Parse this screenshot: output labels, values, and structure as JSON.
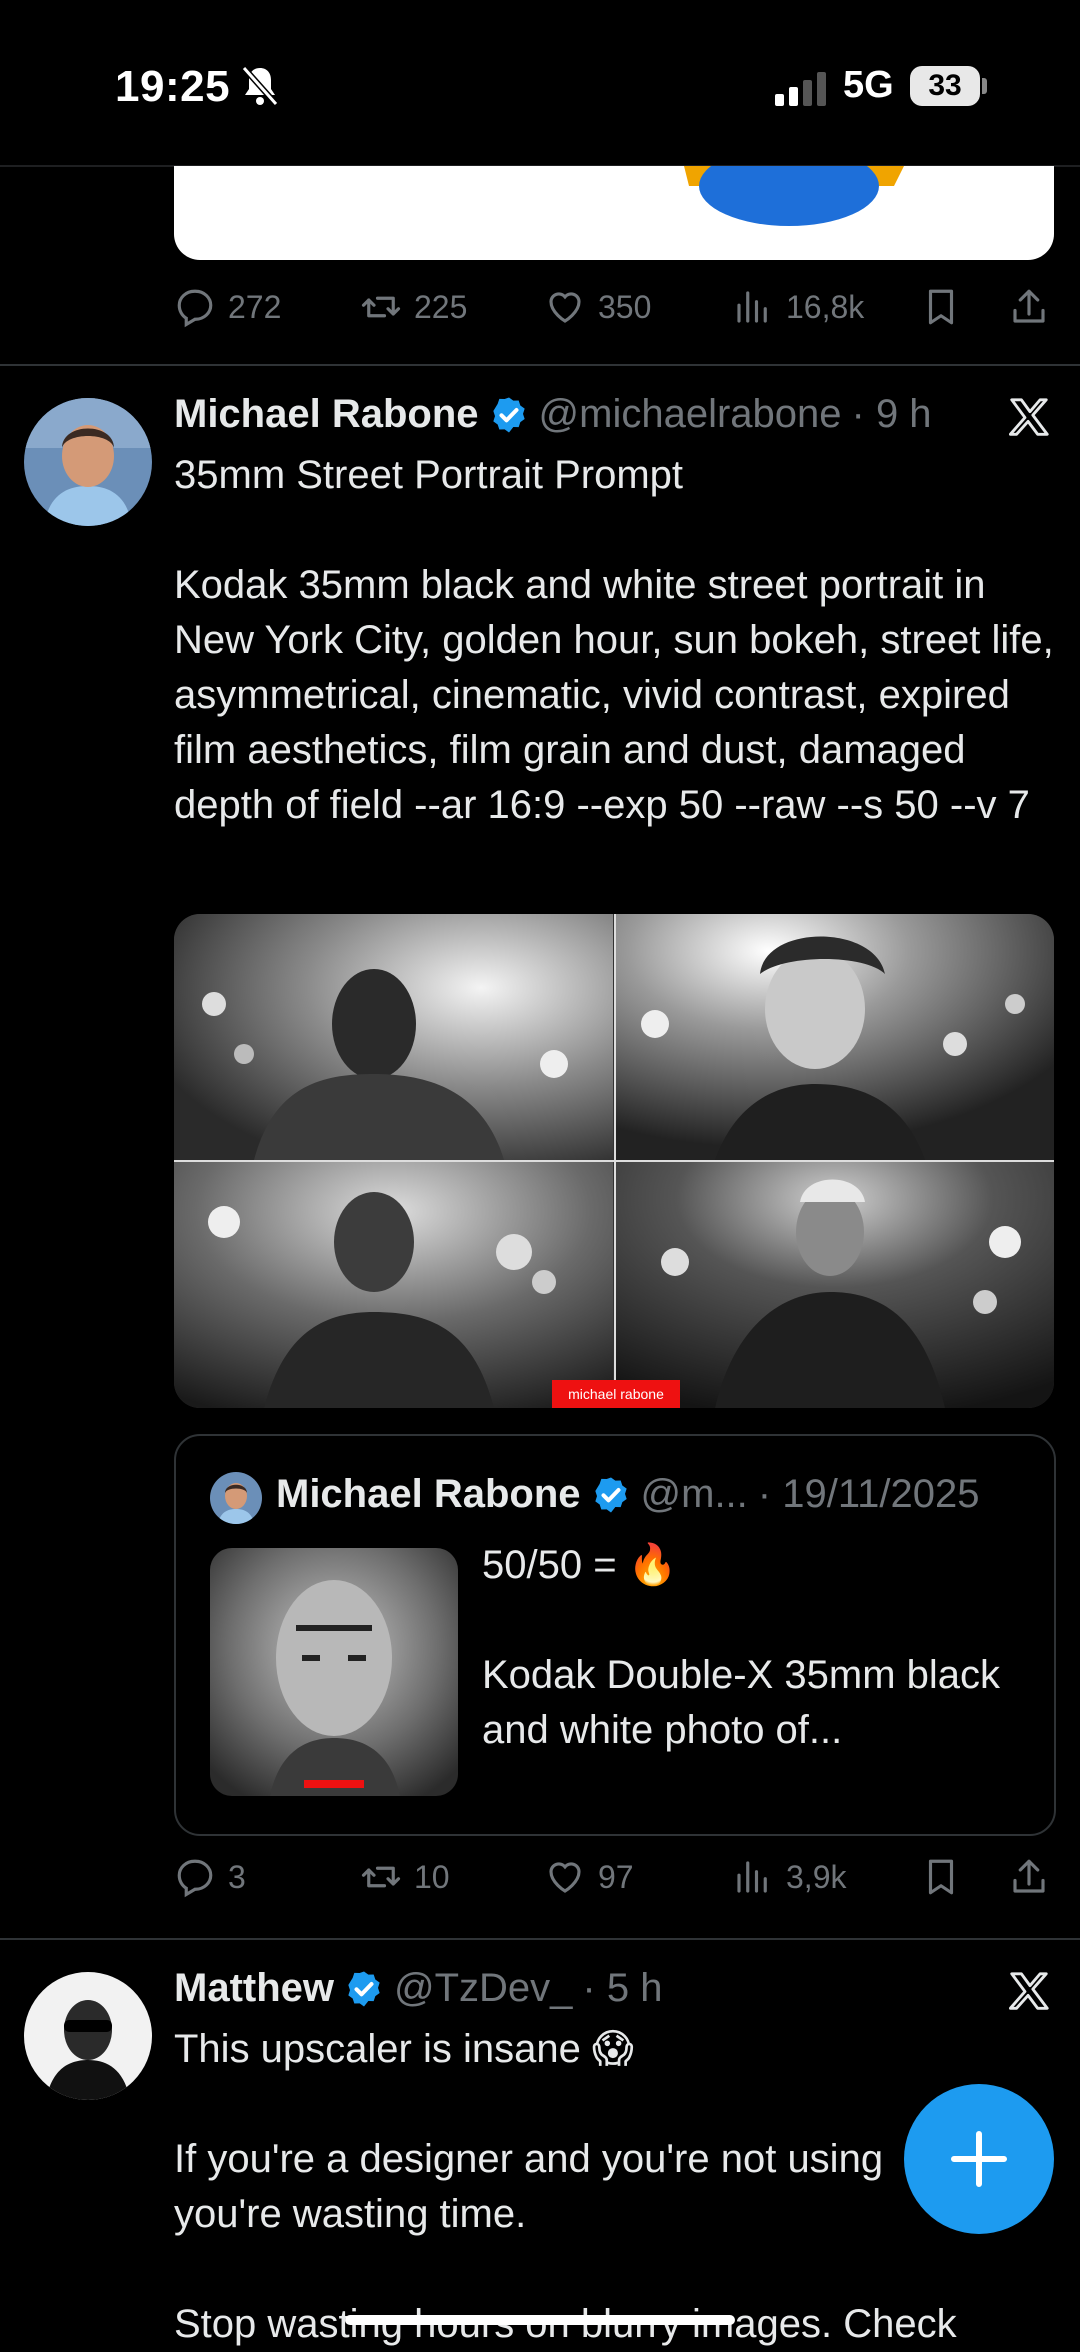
{
  "status_bar": {
    "time": "19:25",
    "network": "5G",
    "battery": "33"
  },
  "prev_tweet": {
    "stats": {
      "replies": "272",
      "reposts": "225",
      "likes": "350",
      "views": "16,8k"
    }
  },
  "tweet1": {
    "author": "Michael Rabone",
    "handle": "@michaelrabone",
    "time": "· 9 h",
    "text": "35mm Street Portrait Prompt\n\nKodak 35mm black and white street portrait in New York City, golden hour, sun bokeh, street life, asymmetrical, cinematic, vivid contrast, expired film aesthetics, film grain and dust, damaged depth of field --ar 16:9 --exp 50 --raw --s 50 --v 7",
    "watermark": "michael rabone",
    "quote": {
      "author": "Michael Rabone",
      "handle": "@m...",
      "date": "· 19/11/2025",
      "text_line1": "50/50 = 🔥",
      "text_line2": "Kodak Double-X 35mm black and white photo of..."
    },
    "stats": {
      "replies": "3",
      "reposts": "10",
      "likes": "97",
      "views": "3,9k"
    }
  },
  "tweet2": {
    "author": "Matthew",
    "handle": "@TzDev_",
    "time": "· 5 h",
    "text_line1": "This upscaler is insane 😱",
    "text_line2": "If you're a designer and you're not using",
    "text_line3": "you're wasting time.",
    "text_line4": "Stop wasting hours on blurry images. Check"
  },
  "colors": {
    "background": "#000000",
    "verified": "#1d9bf0",
    "muted": "#71767b",
    "fab": "#1d9bf0"
  }
}
